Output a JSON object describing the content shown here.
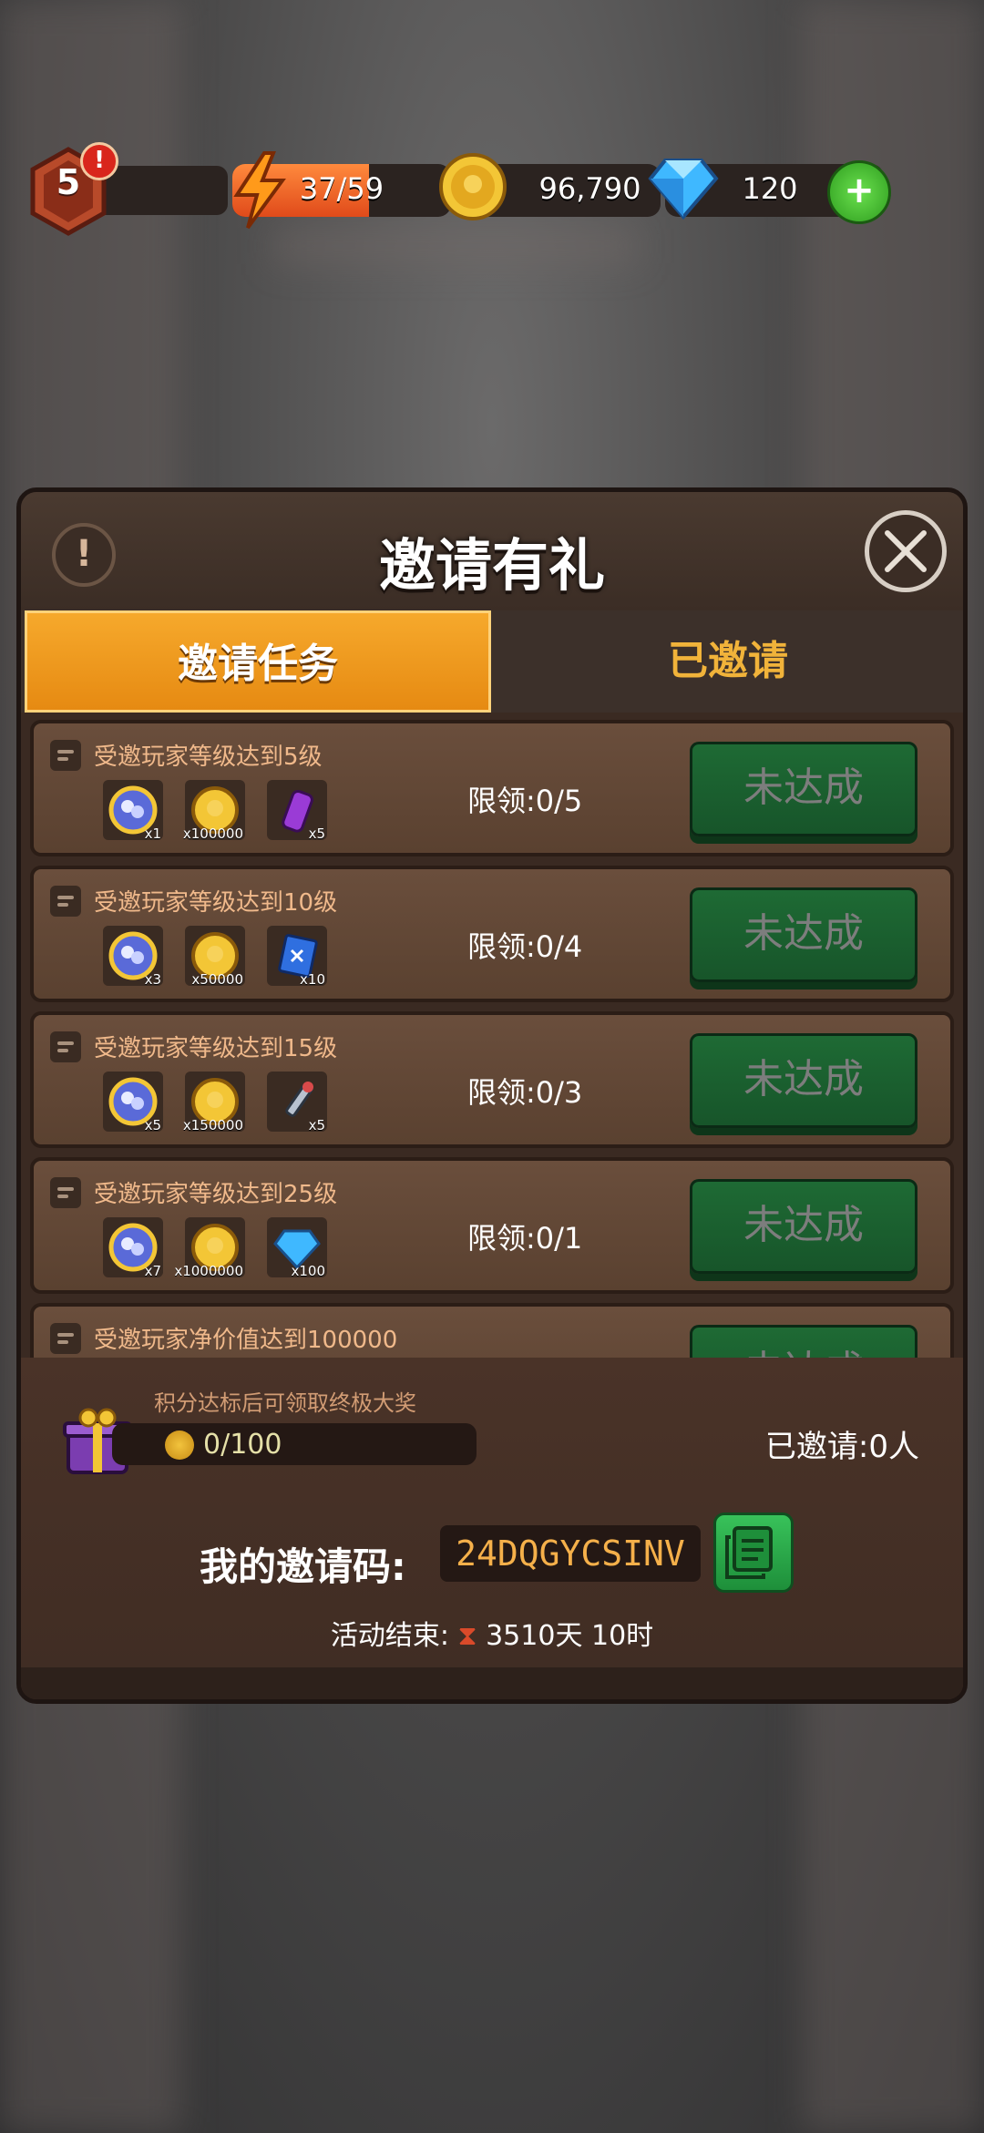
{
  "hud": {
    "level": "5",
    "alert": "!",
    "energy_text": "37/59",
    "energy_fraction": 0.627,
    "coins": "96,790",
    "gems": "120",
    "plus": "+"
  },
  "panel": {
    "title": "邀请有礼",
    "info": "!",
    "tabs": [
      {
        "label": "邀请任务",
        "active": true
      },
      {
        "label": "已邀请",
        "active": false
      }
    ]
  },
  "tasks": [
    {
      "title": "受邀玩家等级达到5级",
      "limit": "限领:0/5",
      "status": "未达成",
      "rewards": [
        {
          "icon": "blue-token-icon",
          "qty": "x1"
        },
        {
          "icon": "gold-coin-icon",
          "qty": "x100000"
        },
        {
          "icon": "energy-can-icon",
          "qty": "x5"
        }
      ]
    },
    {
      "title": "受邀玩家等级达到10级",
      "limit": "限领:0/4",
      "status": "未达成",
      "rewards": [
        {
          "icon": "blue-token-icon",
          "qty": "x3"
        },
        {
          "icon": "gold-coin-icon",
          "qty": "x50000"
        },
        {
          "icon": "blueprint-icon",
          "qty": "x10"
        }
      ]
    },
    {
      "title": "受邀玩家等级达到15级",
      "limit": "限领:0/3",
      "status": "未达成",
      "rewards": [
        {
          "icon": "blue-token-icon",
          "qty": "x5"
        },
        {
          "icon": "gold-coin-icon",
          "qty": "x150000"
        },
        {
          "icon": "syringe-icon",
          "qty": "x5"
        }
      ]
    },
    {
      "title": "受邀玩家等级达到25级",
      "limit": "限领:0/1",
      "status": "未达成",
      "rewards": [
        {
          "icon": "blue-token-icon",
          "qty": "x7"
        },
        {
          "icon": "gold-coin-icon",
          "qty": "x1000000"
        },
        {
          "icon": "diamond-icon",
          "qty": "x100"
        }
      ]
    },
    {
      "title": "受邀玩家净价值达到100000",
      "limit": "",
      "status": "未达成",
      "rewards": []
    }
  ],
  "footer": {
    "progress_hint": "积分达标后可领取终极大奖",
    "progress_text": "0/100",
    "invited_count": "已邀请:0人",
    "code_label": "我的邀请码:",
    "invite_code": "24DQGYCSINV",
    "end_label": "活动结束:",
    "end_time": "3510天 10时"
  },
  "colors": {
    "tab_active": "#f0a022",
    "button_green": "#1e6a34",
    "panel_brown": "#3a2a22"
  }
}
